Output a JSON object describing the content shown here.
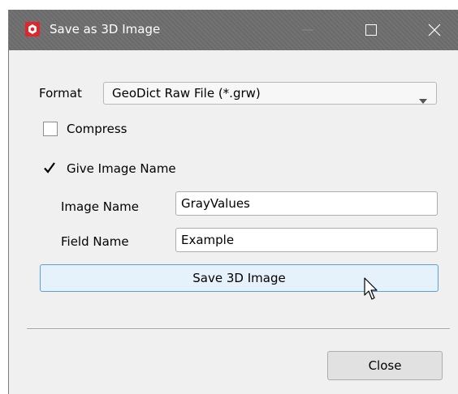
{
  "window": {
    "title": "Save as 3D Image",
    "icon": "geodict-logo-icon"
  },
  "titlebar_buttons": {
    "minimize_icon": "minimize-icon",
    "maximize_icon": "maximize-icon",
    "close_icon": "close-icon"
  },
  "format": {
    "label": "Format",
    "selected": "GeoDict Raw File (*.grw)"
  },
  "compress": {
    "label": "Compress",
    "checked": false
  },
  "give_image_name": {
    "label": "Give Image Name",
    "checked": true
  },
  "image_name": {
    "label": "Image Name",
    "value": "GrayValues"
  },
  "field_name": {
    "label": "Field Name",
    "value": "Example"
  },
  "buttons": {
    "save_label": "Save 3D Image",
    "close_label": "Close"
  },
  "colors": {
    "titlebar": "#6e6e6e",
    "dialog_bg": "#f0f0f0",
    "save_button_hover_bg": "#e5f1fb",
    "save_button_hover_border": "#5aa0e0",
    "logo_red": "#e0252c"
  }
}
